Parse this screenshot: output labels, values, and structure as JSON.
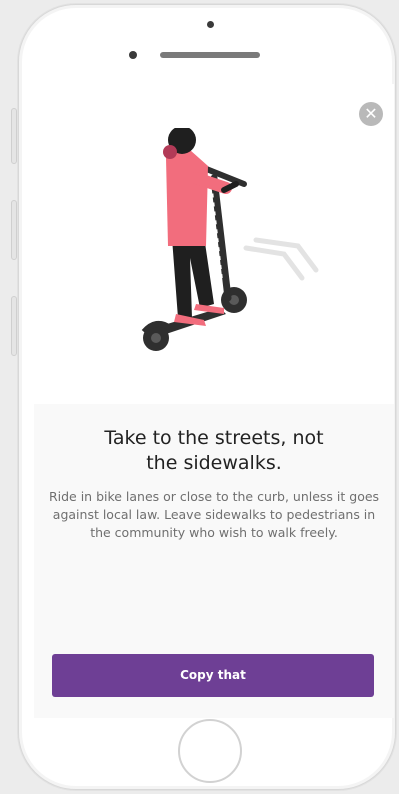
{
  "onboarding": {
    "headline_line1": "Take to the streets, not",
    "headline_line2": "the sidewalks.",
    "body_line1": "Ride in bike lanes or close to the curb, unless it goes",
    "body_line2": "against local law. Leave sidewalks to pedestrians in",
    "body_line3": "the community who wish to walk freely.",
    "cta_label": "Copy that",
    "close_glyph": "✕"
  },
  "icons": {
    "close": "close-icon",
    "illustration": "scooter-rider-illustration"
  },
  "colors": {
    "accent": "#6e3f95",
    "close_bg": "#b9b9b9",
    "shirt": "#f26d7d",
    "scooter": "#2f2f2f"
  }
}
